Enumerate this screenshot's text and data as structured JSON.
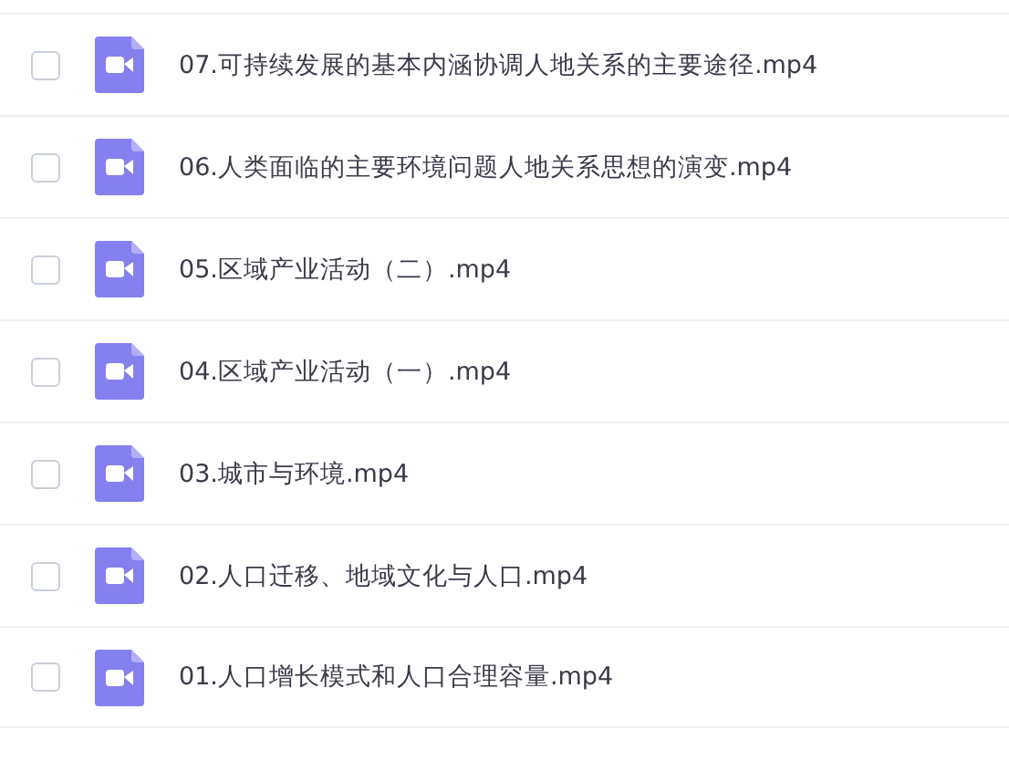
{
  "files": [
    {
      "name": "07.可持续发展的基本内涵协调人地关系的主要途径.mp4",
      "checked": false
    },
    {
      "name": "06.人类面临的主要环境问题人地关系思想的演变.mp4",
      "checked": false
    },
    {
      "name": "05.区域产业活动（二）.mp4",
      "checked": false
    },
    {
      "name": "04.区域产业活动（一）.mp4",
      "checked": false
    },
    {
      "name": "03.城市与环境.mp4",
      "checked": false
    },
    {
      "name": "02.人口迁移、地域文化与人口.mp4",
      "checked": false
    },
    {
      "name": "01.人口增长模式和人口合理容量.mp4",
      "checked": false
    }
  ]
}
